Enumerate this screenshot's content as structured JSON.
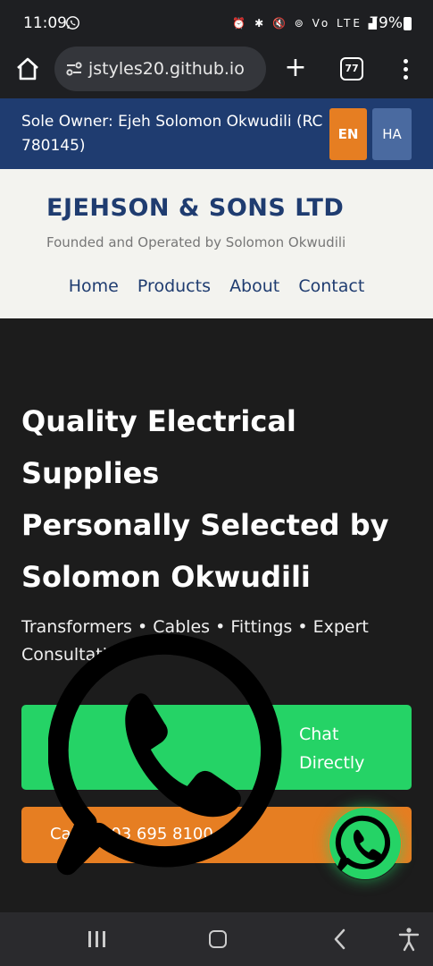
{
  "status_bar": {
    "time": "11:09",
    "icons": "⏰ ✱ 🔇 ⊚ Vo LTE ▟",
    "battery": "79%"
  },
  "browser": {
    "url": "jstyles20.github.io",
    "tab_count": "77"
  },
  "ribbon": {
    "owner_text": "Sole Owner: Ejeh Solomon Okwudili (RC 780145)",
    "lang_en": "EN",
    "lang_ha": "HA"
  },
  "header": {
    "brand": "EJEHSON & SONS LTD",
    "tagline": "Founded and Operated by Solomon Okwudili",
    "nav": [
      "Home",
      "Products",
      "About",
      "Contact"
    ]
  },
  "hero": {
    "title_lines": [
      "Quality Electrical",
      "Supplies",
      "Personally Selected by",
      "Solomon Okwudili"
    ],
    "subtitle": "Transformers • Cables • Fittings • Expert Consultation",
    "chat_label": "Chat Directly",
    "call_label": "Call: 0803 695 8100"
  },
  "colors": {
    "brand_blue": "#1f3c70",
    "accent_orange": "#e67e22",
    "whatsapp_green": "#25d366",
    "hero_bg": "#1c1c1c"
  },
  "icons": {
    "overlay": "whatsapp-icon",
    "fab": "whatsapp-icon"
  }
}
